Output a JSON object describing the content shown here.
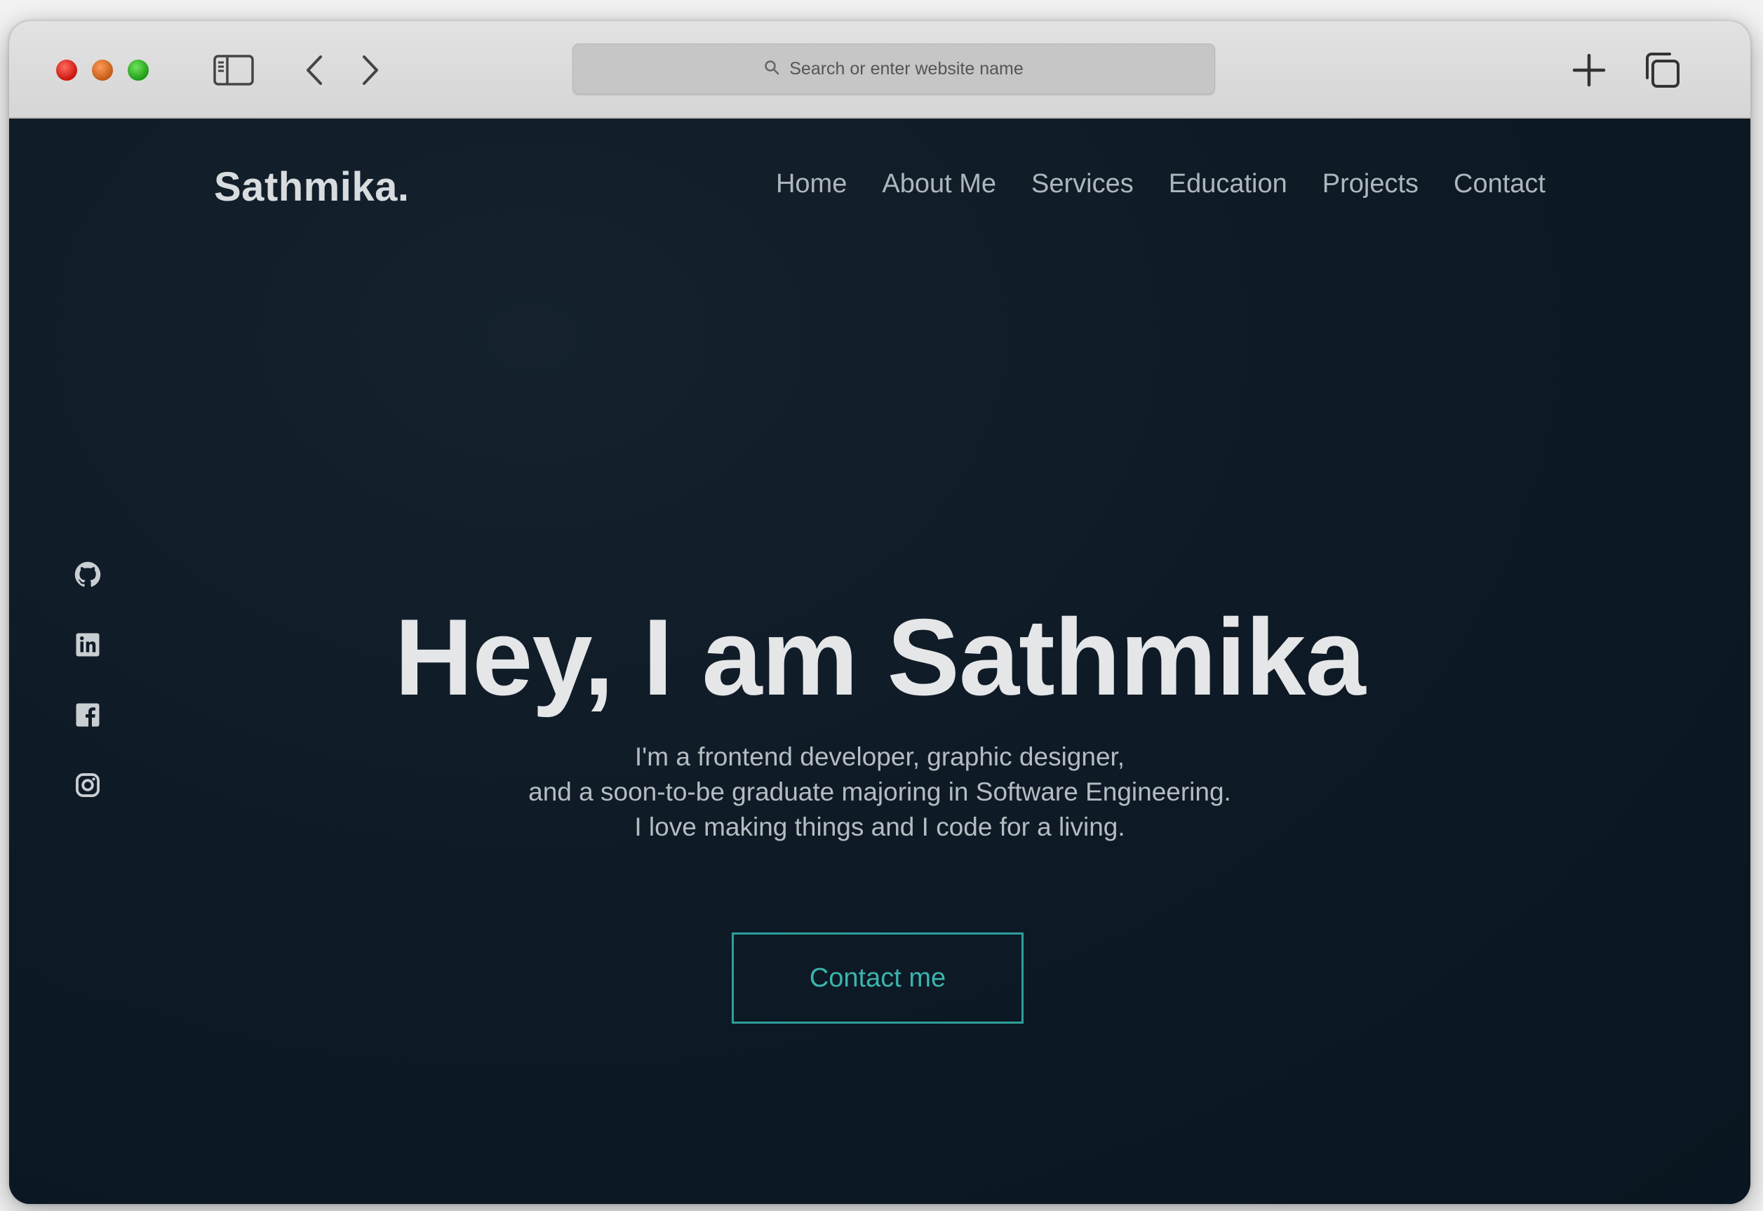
{
  "browser": {
    "address_placeholder": "Search or enter website name",
    "icons": {
      "sidebar": "sidebar-icon",
      "back": "chevron-left-icon",
      "forward": "chevron-right-icon",
      "search": "magnifier-icon",
      "new_tab": "plus-icon",
      "tabs": "tabs-overview-icon"
    }
  },
  "site": {
    "logo": "Sathmika.",
    "nav": [
      "Home",
      "About Me",
      "Services",
      "Education",
      "Projects",
      "Contact"
    ],
    "socials": [
      "github-icon",
      "linkedin-icon",
      "facebook-icon",
      "instagram-icon"
    ],
    "hero": {
      "title": "Hey, I am Sathmika",
      "intro": [
        "I'm a frontend developer, graphic designer,",
        "and a soon-to-be graduate majoring in Software Engineering.",
        "I love making things and I code for a living."
      ],
      "cta": "Contact me"
    }
  },
  "colors": {
    "background": "#0c1823",
    "accent": "#3bb4ae",
    "heading": "#e4e6e8",
    "nav_text": "#aeb6bd"
  }
}
